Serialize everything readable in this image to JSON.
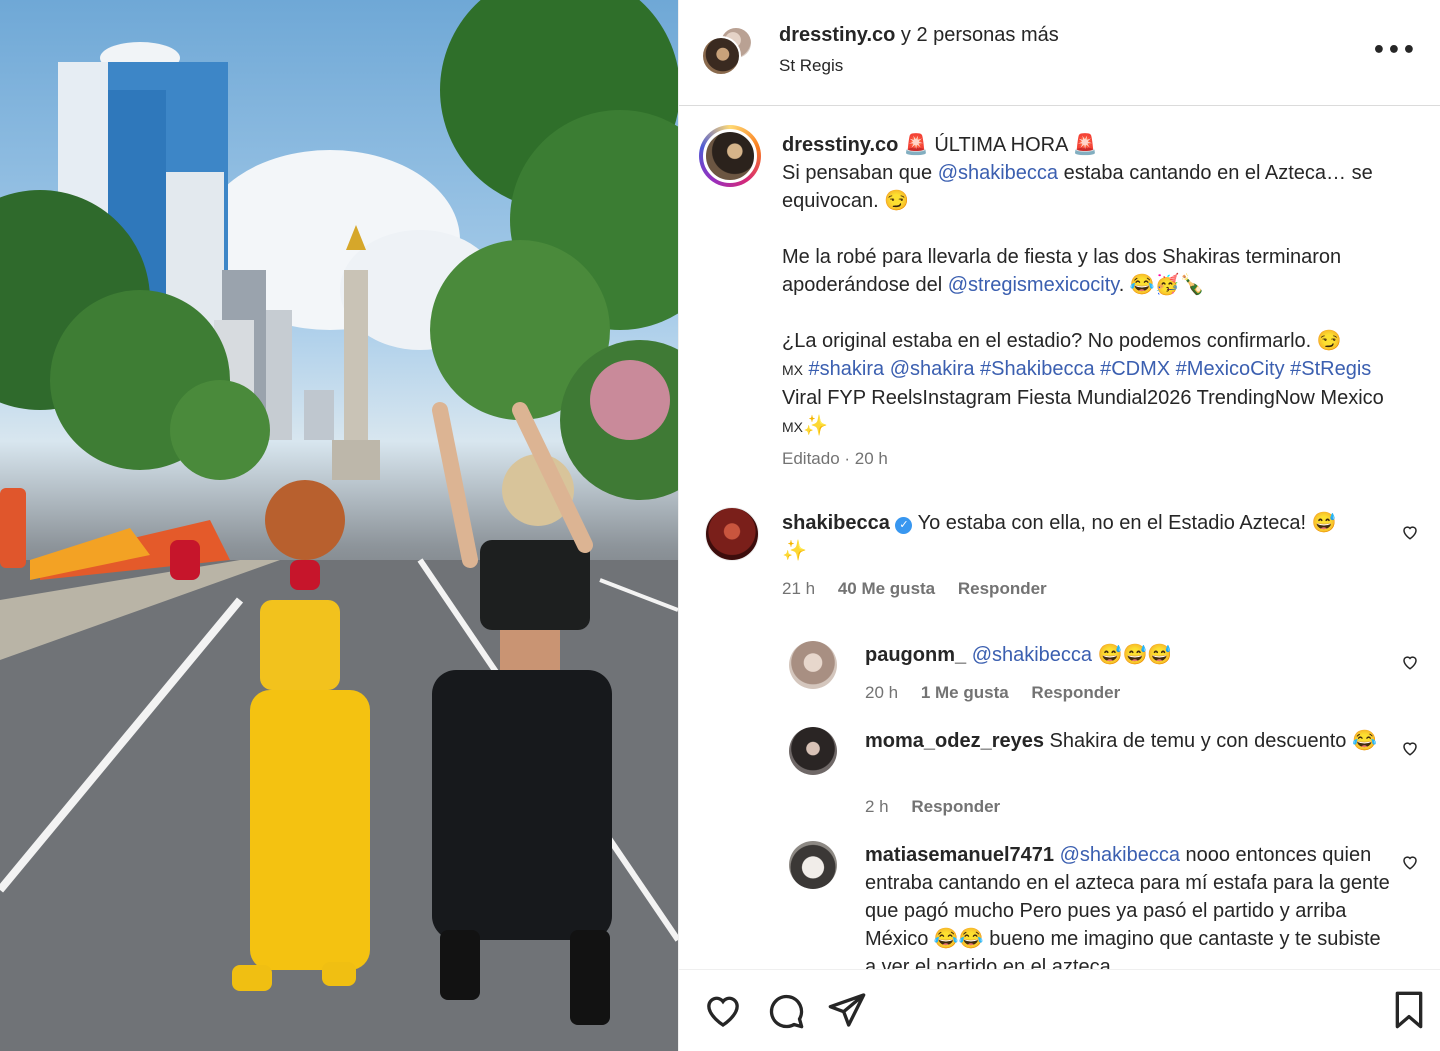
{
  "post": {
    "header": {
      "user": "dresstiny.co",
      "others": "y 2 personas más",
      "location": "St Regis",
      "more_icon": "•••"
    },
    "caption": {
      "user": "dresstiny.co",
      "line1_prefix": " 🚨 ÚLTIMA HORA 🚨",
      "line2_a": "Si pensaban que ",
      "line2_mention": "@shakibecca",
      "line2_b": " estaba cantando en el Azteca… se equivocan. 😏",
      "para2_a": "Me la robé para llevarla de fiesta y las dos Shakiras terminaron apoderándose del ",
      "para2_mention": "@stregismexicocity",
      "para2_b": ". 😂🥳🍾",
      "para3_a": "¿La original estaba en el estadio? No podemos confirmarlo. 😏",
      "para3_flag": "MX",
      "para3_tags": " #shakira @shakira #Shakibecca #CDMX #MexicoCity #StRegis",
      "para3_b": "Viral FYP ReelsInstagram Fiesta Mundial2026 TrendingNow Mexico ",
      "para3_flag2": "MX",
      "para3_end": "✨",
      "edited": "Editado · 20 h"
    },
    "comments": [
      {
        "user": "shakibecca",
        "text": " Yo estaba con ella, no en el Estadio Azteca! 😅 ✨",
        "time": "21 h",
        "likes": "40 Me gusta",
        "reply": "Responder"
      }
    ],
    "replies": [
      {
        "user": "paugonm_",
        "mention": "@shakibecca",
        "text": " 😅😅😅",
        "time": "20 h",
        "likes": "1 Me gusta",
        "reply": "Responder"
      },
      {
        "user": "moma_odez_reyes",
        "text": " Shakira de temu y con descuento 😂",
        "time": "2 h",
        "reply": "Responder"
      },
      {
        "user": "matiasemanuel7471",
        "mention": "@shakibecca",
        "text": " nooo entonces quien entraba cantando en el azteca para mí estafa para la gente que pagó mucho Pero pues ya pasó el partido y arriba México 😂😂 bueno me imagino que cantaste y te subiste a ver el partido en el azteca"
      }
    ]
  },
  "icons": {
    "heart": "heart-icon",
    "comment": "comment-icon",
    "share": "paper-plane-icon",
    "save": "bookmark-icon"
  },
  "colors": {
    "mention": "#3b5fb0",
    "verified": "#3897f0",
    "text": "#262626",
    "meta": "#737373"
  }
}
